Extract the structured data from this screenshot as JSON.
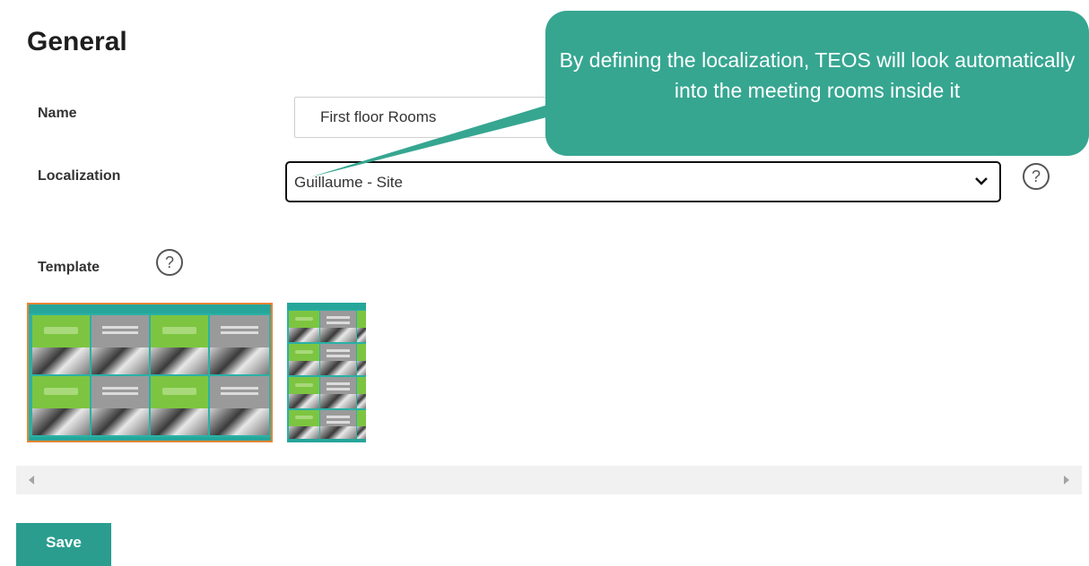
{
  "page": {
    "title": "General"
  },
  "form": {
    "name_label": "Name",
    "name_value": "First floor Rooms",
    "localization_label": "Localization",
    "localization_value": "Guillaume - Site",
    "template_label": "Template"
  },
  "help_icon_glyph": "?",
  "actions": {
    "save_label": "Save"
  },
  "callout": {
    "text": "By defining the localization, TEOS will look automatically into the meeting rooms inside it"
  },
  "colors": {
    "accent": "#2a9d8f",
    "callout": "#36a691",
    "selected_border": "#e88434",
    "tile_green": "#7dc540",
    "tile_gray": "#9a9a9a"
  },
  "templates": [
    {
      "name": "template-landscape",
      "selected": true
    },
    {
      "name": "template-portrait",
      "selected": false
    }
  ]
}
